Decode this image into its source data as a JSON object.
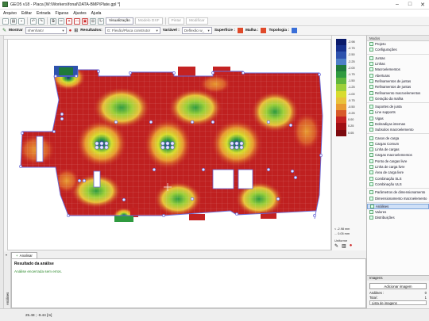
{
  "window": {
    "title": "GEO5 v18 - Placa [W:\\Workers\\fonal\\DATA-BMP\\Plate.gpl *]"
  },
  "menu": [
    "Arquivo",
    "Editar",
    "Entrada",
    "Figuras",
    "Ajustes",
    "Ajuda"
  ],
  "toolbar": {
    "visualization": "Visualização",
    "model_dxf": "Modelo DXF",
    "print": "Pintar",
    "modify": "Modificar"
  },
  "toolbar2": {
    "show_label": "Mostrar",
    "show_value": "nhenhatcr",
    "results_label": "Resultados:",
    "results_value": "G: Flexão/Placa construtor",
    "variable_label": "Variável :",
    "variable_value": "Deflexão w_",
    "surface_label": "Superfície :",
    "mesh_label": "Malha :",
    "topology_label": "Topologia :"
  },
  "legend": {
    "labels": [
      "-2.98",
      "-2.75",
      "-2.50",
      "-2.25",
      "-2.00",
      "-1.75",
      "-1.50",
      "-1.25",
      "-1.00",
      "-0.75",
      "-0.50",
      "-0.25",
      "0.00",
      "0.25",
      "0.05"
    ],
    "colors": [
      "#0a1a6a",
      "#16308c",
      "#2d52ad",
      "#4d7fc7",
      "#1f7a3a",
      "#2f9a3f",
      "#5fb63c",
      "#9ccf3a",
      "#d8dc2e",
      "#e9c23a",
      "#e89a30",
      "#d85a2a",
      "#c42222",
      "#a00f14",
      "#7c0a0e"
    ],
    "min_text": "< -2.98 mm",
    "max_text": "... 0.05 mm",
    "uniform": "Uniforme"
  },
  "modes_header": "Modos",
  "right_panel": {
    "items": [
      "Projeto",
      "Configurações",
      "Juntas",
      "Linhas",
      "Macroelementos",
      "Aberturas",
      "Refinamentos de juntas",
      "Refinamentos de juntas",
      "Refinamento macroelementos",
      "Geração da malha",
      "Suportes de junta",
      "Line supports",
      "Vigas",
      "Dobradiças internas",
      "Subsolos macroelemento",
      "Casos de carga",
      "Cargas Comum",
      "Linha de cargas",
      "Cargas macroelementos",
      "Ponto de cargas livre",
      "Linha de carga livre",
      "Área de carga livre",
      "Combinação SLS",
      "Combinação ULS",
      "Parâmetros de dimensionamento",
      "Dimensionamento macroelemento",
      "Análises",
      "Valores",
      "Distribuições"
    ],
    "active_index": 26
  },
  "images_panel": {
    "header": "Imagens",
    "add_button": "Adicionar imagem",
    "analyses_label": "Análises :",
    "analyses_value": "0",
    "total_label": "Total :",
    "total_value": "1",
    "list_label": "Lista de imagens"
  },
  "analysis": {
    "tab_label": "Analisar",
    "title": "Resultado da análise",
    "message": "Análise encerrada sem erros.",
    "side_label": "Análises"
  },
  "status": {
    "coords": "25.48 ; -9.44 [m]"
  }
}
